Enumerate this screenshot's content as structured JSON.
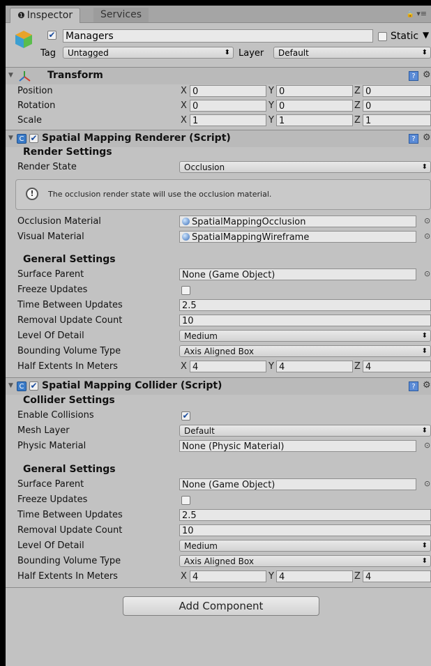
{
  "tabs": {
    "inspector": "Inspector",
    "services": "Services",
    "inspector_glyph": "❶",
    "lock_glyph": "🔒",
    "menu_glyph": "▾≡"
  },
  "object": {
    "name": "Managers",
    "static_label": "Static",
    "tag_label": "Tag",
    "tag_value": "Untagged",
    "layer_label": "Layer",
    "layer_value": "Default",
    "active": true,
    "static": false
  },
  "transform": {
    "title": "Transform",
    "position_label": "Position",
    "position": {
      "x": "0",
      "y": "0",
      "z": "0"
    },
    "rotation_label": "Rotation",
    "rotation": {
      "x": "0",
      "y": "0",
      "z": "0"
    },
    "scale_label": "Scale",
    "scale": {
      "x": "1",
      "y": "1",
      "z": "1"
    }
  },
  "axes": {
    "x": "X",
    "y": "Y",
    "z": "Z"
  },
  "renderer": {
    "title": "Spatial Mapping Renderer (Script)",
    "render_settings": "Render Settings",
    "render_state_label": "Render State",
    "render_state_value": "Occlusion",
    "help_text": "The occlusion render state will use the occlusion material.",
    "occlusion_material_label": "Occlusion Material",
    "occlusion_material_value": "SpatialMappingOcclusion",
    "visual_material_label": "Visual Material",
    "visual_material_value": "SpatialMappingWireframe",
    "general_settings": "General Settings",
    "surface_parent_label": "Surface Parent",
    "surface_parent_value": "None (Game Object)",
    "freeze_updates_label": "Freeze Updates",
    "time_between_label": "Time Between Updates",
    "time_between_value": "2.5",
    "removal_count_label": "Removal Update Count",
    "removal_count_value": "10",
    "lod_label": "Level Of Detail",
    "lod_value": "Medium",
    "bvt_label": "Bounding Volume Type",
    "bvt_value": "Axis Aligned Box",
    "half_extents_label": "Half Extents In Meters",
    "half_extents": {
      "x": "4",
      "y": "4",
      "z": "4"
    }
  },
  "collider": {
    "title": "Spatial Mapping Collider (Script)",
    "collider_settings": "Collider Settings",
    "enable_collisions_label": "Enable Collisions",
    "mesh_layer_label": "Mesh Layer",
    "mesh_layer_value": "Default",
    "physic_material_label": "Physic Material",
    "physic_material_value": "None (Physic Material)",
    "general_settings": "General Settings",
    "surface_parent_label": "Surface Parent",
    "surface_parent_value": "None (Game Object)",
    "freeze_updates_label": "Freeze Updates",
    "time_between_label": "Time Between Updates",
    "time_between_value": "2.5",
    "removal_count_label": "Removal Update Count",
    "removal_count_value": "10",
    "lod_label": "Level Of Detail",
    "lod_value": "Medium",
    "bvt_label": "Bounding Volume Type",
    "bvt_value": "Axis Aligned Box",
    "half_extents_label": "Half Extents In Meters",
    "half_extents": {
      "x": "4",
      "y": "4",
      "z": "4"
    }
  },
  "add_component": "Add Component",
  "colors": {
    "panel": "#c2c2c2",
    "header": "#bababa",
    "field": "#e7e7e7",
    "accent": "#3a7bc8"
  }
}
